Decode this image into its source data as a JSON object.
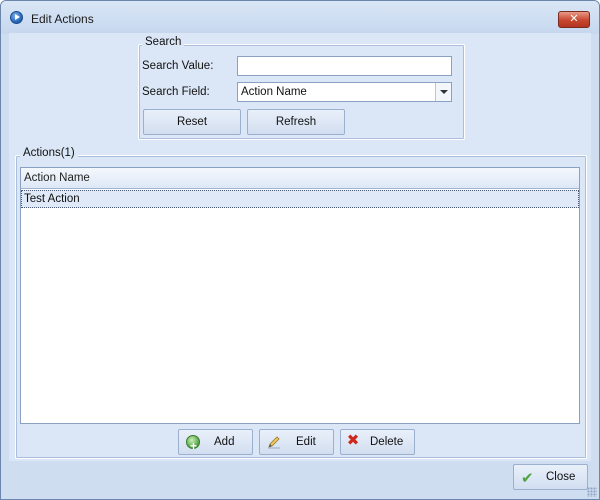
{
  "window": {
    "title": "Edit Actions",
    "close_glyph": "✕"
  },
  "search": {
    "legend": "Search",
    "value_label": "Search Value:",
    "value_input": "",
    "field_label": "Search Field:",
    "field_selected": "Action Name",
    "reset_label": "Reset",
    "refresh_label": "Refresh"
  },
  "actions": {
    "legend": "Actions(1)",
    "columns": [
      "Action Name"
    ],
    "rows": [
      [
        "Test Action"
      ]
    ],
    "add_label": "Add",
    "edit_label": "Edit",
    "delete_label": "Delete",
    "delete_glyph": "✖"
  },
  "footer": {
    "close_label": "Close"
  },
  "icons": {
    "app": "app-icon",
    "add": "add-icon",
    "edit": "pencil-icon",
    "delete": "delete-icon",
    "close": "check-icon"
  },
  "colors": {
    "client_bg": "#dbe7f7",
    "title_close": "#c8462f",
    "selected_row": "#dfe9f7"
  }
}
